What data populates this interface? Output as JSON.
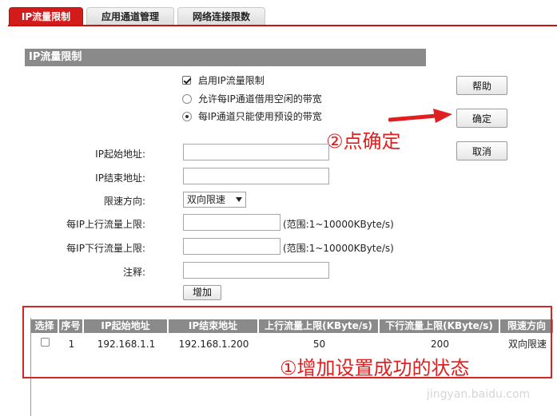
{
  "tabs": [
    {
      "label": "IP流量限制",
      "active": true
    },
    {
      "label": "应用通道管理",
      "active": false
    },
    {
      "label": "网络连接限数",
      "active": false
    }
  ],
  "section_title": "IP流量限制",
  "options": {
    "enable": {
      "label": "启用IP流量限制",
      "checked": true
    },
    "borrow": {
      "label": "允许每IP通道借用空闲的带宽",
      "checked": false
    },
    "preset": {
      "label": "每IP通道只能使用预设的带宽",
      "checked": true
    }
  },
  "buttons": {
    "help": "帮助",
    "confirm": "确定",
    "cancel": "取消",
    "add": "增加"
  },
  "form": {
    "start_ip": {
      "label": "IP起始地址:",
      "value": ""
    },
    "end_ip": {
      "label": "IP结束地址:",
      "value": ""
    },
    "direction": {
      "label": "限速方向:",
      "value": "双向限速"
    },
    "up_limit": {
      "label": "每IP上行流量上限:",
      "value": "",
      "hint": "(范围:1~10000KByte/s)"
    },
    "down_limit": {
      "label": "每IP下行流量上限:",
      "value": "",
      "hint": "(范围:1~10000KByte/s)"
    },
    "note": {
      "label": "注释:",
      "value": ""
    }
  },
  "table": {
    "headers": [
      "选择",
      "序号",
      "IP起始地址",
      "IP结束地址",
      "上行流量上限(KByte/s)",
      "下行流量上限(KByte/s)",
      "限速方向"
    ],
    "rows": [
      {
        "selected": false,
        "index": "1",
        "start": "192.168.1.1",
        "end": "192.168.1.200",
        "up": "50",
        "down": "200",
        "direction": "双向限速"
      }
    ]
  },
  "annotations": {
    "step2": "②点确定",
    "step1": "①增加设置成功的状态",
    "watermark": "jingyan.baidu.com"
  },
  "colors": {
    "accent": "#d21b1b",
    "header_gray": "#8a8a8a",
    "annotation_red": "#e02020"
  }
}
